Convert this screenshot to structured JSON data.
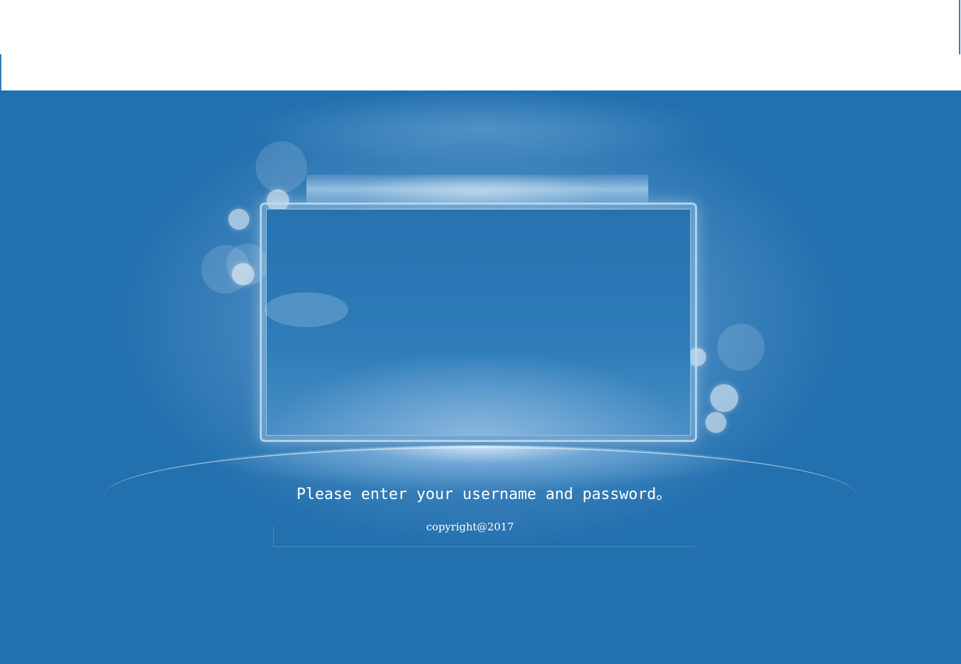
{
  "login": {
    "message": "Please enter your username and password。",
    "copyright": "copyright@2017"
  },
  "colors": {
    "background": "#2370ae",
    "panel_border": "#bedcf2",
    "text": "#ffffff"
  }
}
